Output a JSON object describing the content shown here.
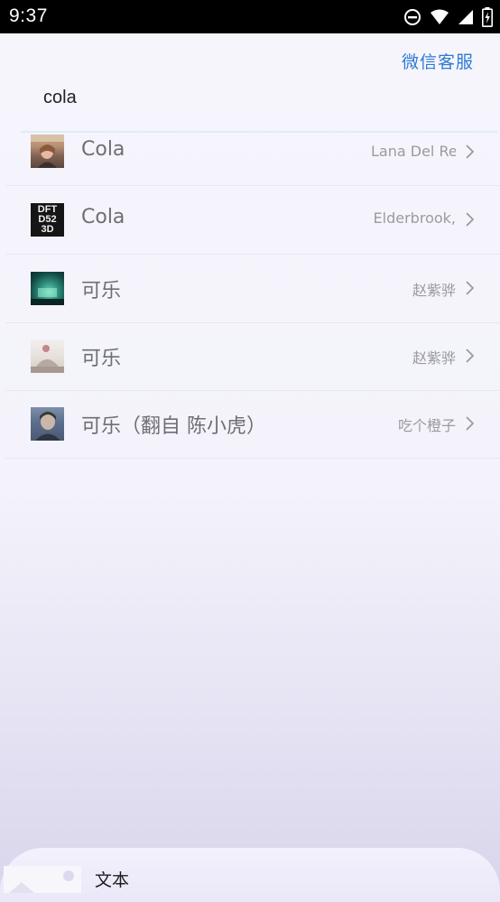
{
  "status_bar": {
    "time": "9:37",
    "icons": [
      "do-not-disturb-icon",
      "wifi-icon",
      "signal-icon",
      "battery-charging-icon"
    ]
  },
  "header": {
    "service_link": "微信客服"
  },
  "search": {
    "query": "cola"
  },
  "results": [
    {
      "title": "Cola",
      "artist": "Lana Del Re",
      "thumb": "album-cover-lana"
    },
    {
      "title": "Cola",
      "artist": "Elderbrook,",
      "thumb": "album-cover-daft"
    },
    {
      "title": "可乐",
      "artist": "赵紫骅",
      "thumb": "album-cover-green"
    },
    {
      "title": "可乐",
      "artist": "赵紫骅",
      "thumb": "album-cover-light"
    },
    {
      "title": "可乐（翻自 陈小虎）",
      "artist": "吃个橙子",
      "thumb": "album-cover-blue"
    }
  ],
  "album_art_text": {
    "daft": "DFT D52 3D"
  },
  "bottom_sheet": {
    "label": "文本"
  },
  "colors": {
    "accent": "#2f7bd2",
    "title_text": "#6e6e74",
    "artist_text": "#9a9aa0"
  }
}
